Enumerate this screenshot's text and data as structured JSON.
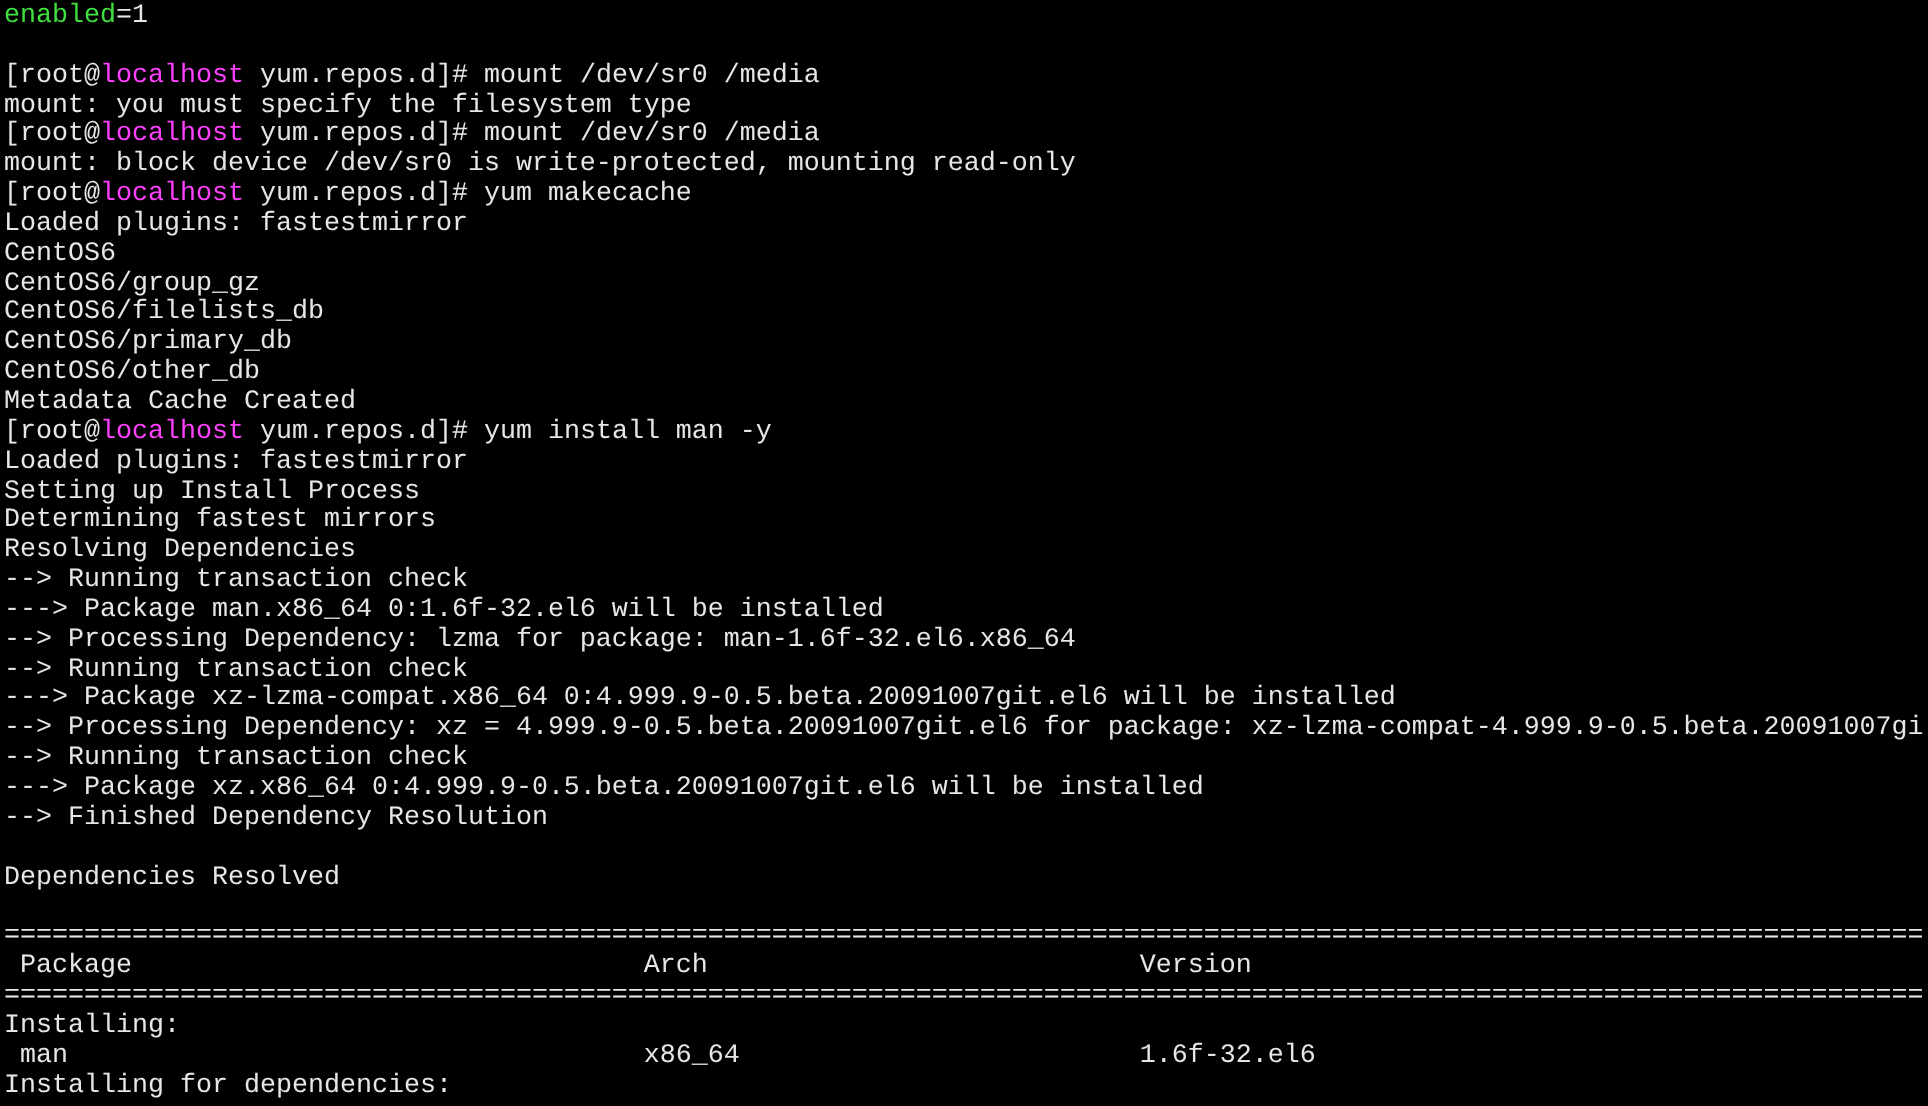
{
  "terminal": {
    "lines": [
      {
        "kind": "text",
        "segments": [
          {
            "text": "enabled",
            "color": "#40e040"
          },
          {
            "text": "=1"
          }
        ]
      },
      {
        "kind": "blank"
      },
      {
        "kind": "text",
        "segments": [
          {
            "text": "[root@"
          },
          {
            "text": "localhost",
            "color": "#ff40ff"
          },
          {
            "text": " yum.repos.d]# mount /dev/sr0 /media"
          }
        ]
      },
      {
        "kind": "text",
        "segments": [
          {
            "text": "mount: you must specify the filesystem type"
          }
        ]
      },
      {
        "kind": "text",
        "segments": [
          {
            "text": "[root@"
          },
          {
            "text": "localhost",
            "color": "#ff40ff"
          },
          {
            "text": " yum.repos.d]# mount /dev/sr0 /media"
          }
        ]
      },
      {
        "kind": "text",
        "segments": [
          {
            "text": "mount: block device /dev/sr0 is write-protected, mounting read-only"
          }
        ]
      },
      {
        "kind": "text",
        "segments": [
          {
            "text": "[root@"
          },
          {
            "text": "localhost",
            "color": "#ff40ff"
          },
          {
            "text": " yum.repos.d]# yum makecache"
          }
        ]
      },
      {
        "kind": "text",
        "segments": [
          {
            "text": "Loaded plugins: fastestmirror"
          }
        ]
      },
      {
        "kind": "text",
        "segments": [
          {
            "text": "CentOS6"
          }
        ]
      },
      {
        "kind": "text",
        "segments": [
          {
            "text": "CentOS6/group_gz"
          }
        ]
      },
      {
        "kind": "text",
        "segments": [
          {
            "text": "CentOS6/filelists_db"
          }
        ]
      },
      {
        "kind": "text",
        "segments": [
          {
            "text": "CentOS6/primary_db"
          }
        ]
      },
      {
        "kind": "text",
        "segments": [
          {
            "text": "CentOS6/other_db"
          }
        ]
      },
      {
        "kind": "text",
        "segments": [
          {
            "text": "Metadata Cache Created"
          }
        ]
      },
      {
        "kind": "text",
        "segments": [
          {
            "text": "[root@"
          },
          {
            "text": "localhost",
            "color": "#ff40ff"
          },
          {
            "text": " yum.repos.d]# yum install man -y"
          }
        ]
      },
      {
        "kind": "text",
        "segments": [
          {
            "text": "Loaded plugins: fastestmirror"
          }
        ]
      },
      {
        "kind": "text",
        "segments": [
          {
            "text": "Setting up Install Process"
          }
        ]
      },
      {
        "kind": "text",
        "segments": [
          {
            "text": "Determining fastest mirrors"
          }
        ]
      },
      {
        "kind": "text",
        "segments": [
          {
            "text": "Resolving Dependencies"
          }
        ]
      },
      {
        "kind": "text",
        "segments": [
          {
            "text": "--> Running transaction check"
          }
        ]
      },
      {
        "kind": "text",
        "segments": [
          {
            "text": "---> Package man.x86_64 0:1.6f-32.el6 will be installed"
          }
        ]
      },
      {
        "kind": "text",
        "segments": [
          {
            "text": "--> Processing Dependency: lzma for package: man-1.6f-32.el6.x86_64"
          }
        ]
      },
      {
        "kind": "text",
        "segments": [
          {
            "text": "--> Running transaction check"
          }
        ]
      },
      {
        "kind": "text",
        "segments": [
          {
            "text": "---> Package xz-lzma-compat.x86_64 0:4.999.9-0.5.beta.20091007git.el6 will be installed"
          }
        ]
      },
      {
        "kind": "text",
        "segments": [
          {
            "text": "--> Processing Dependency: xz = 4.999.9-0.5.beta.20091007git.el6 for package: xz-lzma-compat-4.999.9-0.5.beta.20091007gi"
          }
        ]
      },
      {
        "kind": "text",
        "segments": [
          {
            "text": "--> Running transaction check"
          }
        ]
      },
      {
        "kind": "text",
        "segments": [
          {
            "text": "---> Package xz.x86_64 0:4.999.9-0.5.beta.20091007git.el6 will be installed"
          }
        ]
      },
      {
        "kind": "text",
        "segments": [
          {
            "text": "--> Finished Dependency Resolution"
          }
        ]
      },
      {
        "kind": "blank"
      },
      {
        "kind": "text",
        "segments": [
          {
            "text": "Dependencies Resolved"
          }
        ]
      },
      {
        "kind": "blank"
      },
      {
        "kind": "rule",
        "text": "========================================================================================================================"
      },
      {
        "kind": "header",
        "cells": [
          "Package",
          "Arch",
          "Version"
        ]
      },
      {
        "kind": "rule",
        "text": "========================================================================================================================"
      },
      {
        "kind": "text",
        "segments": [
          {
            "text": "Installing:"
          }
        ]
      },
      {
        "kind": "row",
        "cells": [
          "man",
          "x86_64",
          "1.6f-32.el6"
        ]
      },
      {
        "kind": "text",
        "segments": [
          {
            "text": "Installing for dependencies:"
          }
        ]
      }
    ]
  }
}
